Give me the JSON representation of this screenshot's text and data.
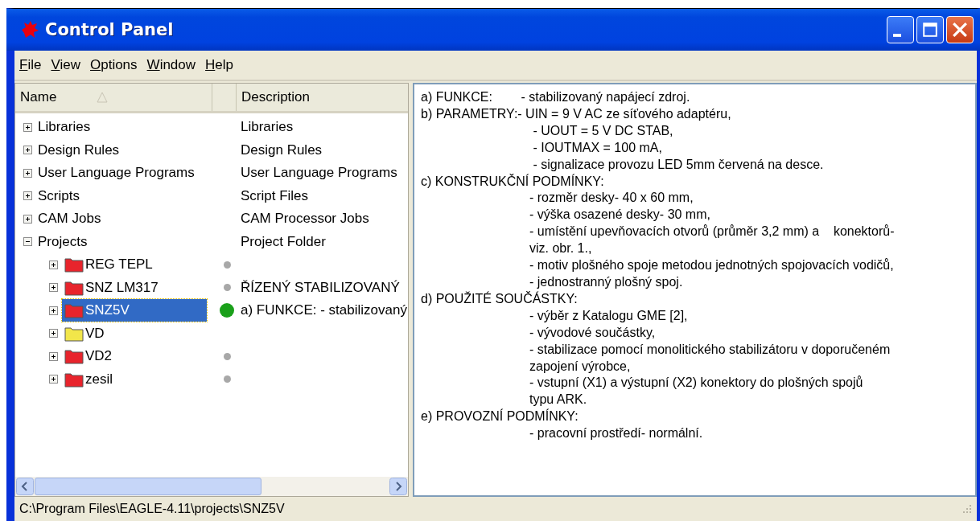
{
  "window": {
    "title": "Control Panel"
  },
  "menu": [
    "File",
    "View",
    "Options",
    "Window",
    "Help"
  ],
  "tree": {
    "columns": [
      "Name",
      "Description"
    ],
    "items": [
      {
        "name": "Libraries",
        "description": "Libraries",
        "expanded": false,
        "selected": false
      },
      {
        "name": "Design Rules",
        "description": "Design Rules",
        "expanded": false,
        "selected": false
      },
      {
        "name": "User Language Programs",
        "description": "User Language Programs",
        "expanded": false,
        "selected": false
      },
      {
        "name": "Scripts",
        "description": "Script Files",
        "expanded": false,
        "selected": false
      },
      {
        "name": "CAM Jobs",
        "description": "CAM Processor Jobs",
        "expanded": false,
        "selected": false
      },
      {
        "name": "Projects",
        "description": "Project Folder",
        "expanded": true,
        "selected": false,
        "children": [
          {
            "name": "REG TEPL",
            "kind": "project",
            "color": "#a8a8a8",
            "open": false,
            "expanded": false,
            "selected": false
          },
          {
            "name": "SNZ LM317",
            "kind": "project",
            "color": "#a8a8a8",
            "open": false,
            "description": "ŘÍZENÝ STABILIZOVANÝ",
            "expanded": false,
            "selected": false
          },
          {
            "name": "SNZ5V",
            "kind": "project",
            "color": "#1aa01a",
            "open": true,
            "description": "a) FUNKCE: - stabilizovaný",
            "expanded": false,
            "selected": true
          },
          {
            "name": "VD",
            "kind": "folder",
            "expanded": false,
            "selected": false
          },
          {
            "name": "VD2",
            "kind": "project",
            "color": "#a8a8a8",
            "open": false,
            "expanded": false,
            "selected": false
          },
          {
            "name": "zesil",
            "kind": "project",
            "color": "#a8a8a8",
            "open": false,
            "expanded": false,
            "selected": false
          }
        ]
      }
    ]
  },
  "description_lines": [
    {
      "kind": "heading",
      "text": "a) FUNKCE:        - stabilizovaný napájecí zdroj."
    },
    {
      "kind": "heading",
      "text": "b) PARAMETRY:- UIN = 9 V AC ze síťového adaptéru,"
    },
    {
      "kind": "detail",
      "text": " - UOUT = 5 V DC STAB,"
    },
    {
      "kind": "detail",
      "text": " - IOUTMAX = 100 mA,"
    },
    {
      "kind": "detail",
      "text": " - signalizace provozu LED 5mm červená na desce."
    },
    {
      "kind": "heading",
      "text": "c) KONSTRUKČNÍ PODMÍNKY:"
    },
    {
      "kind": "detail",
      "text": "- rozměr desky- 40 x 60 mm,"
    },
    {
      "kind": "detail",
      "text": "- výška osazené desky- 30 mm,"
    },
    {
      "kind": "detail",
      "text": "- umístění upevňovacích otvorů (průměr 3,2 mm) a    konektorů-"
    },
    {
      "kind": "detail",
      "text": "viz. obr. 1.,"
    },
    {
      "kind": "detail",
      "text": "- motiv plošného spoje metodou jednotných spojovacích vodičů,"
    },
    {
      "kind": "detail",
      "text": "- jednostranný plošný spoj."
    },
    {
      "kind": "heading",
      "text": "d) POUŽITÉ SOUČÁSTKY:"
    },
    {
      "kind": "detail",
      "text": "- výběr z Katalogu GME [2],"
    },
    {
      "kind": "detail",
      "text": "- vývodové součástky,"
    },
    {
      "kind": "detail",
      "text": "- stabilizace pomocí monolitického stabilizátoru v doporučeném"
    },
    {
      "kind": "detail",
      "text": "zapojení výrobce,"
    },
    {
      "kind": "detail",
      "text": "- vstupní (X1) a výstupní (X2) konektory do plošných spojů"
    },
    {
      "kind": "detail",
      "text": "typu ARK."
    },
    {
      "kind": "heading",
      "text": "e) PROVOZNÍ PODMÍNKY:"
    },
    {
      "kind": "detail",
      "text": "- pracovní prostředí- normální."
    }
  ],
  "status_bar": "C:\\Program Files\\EAGLE-4.11\\projects\\SNZ5V"
}
